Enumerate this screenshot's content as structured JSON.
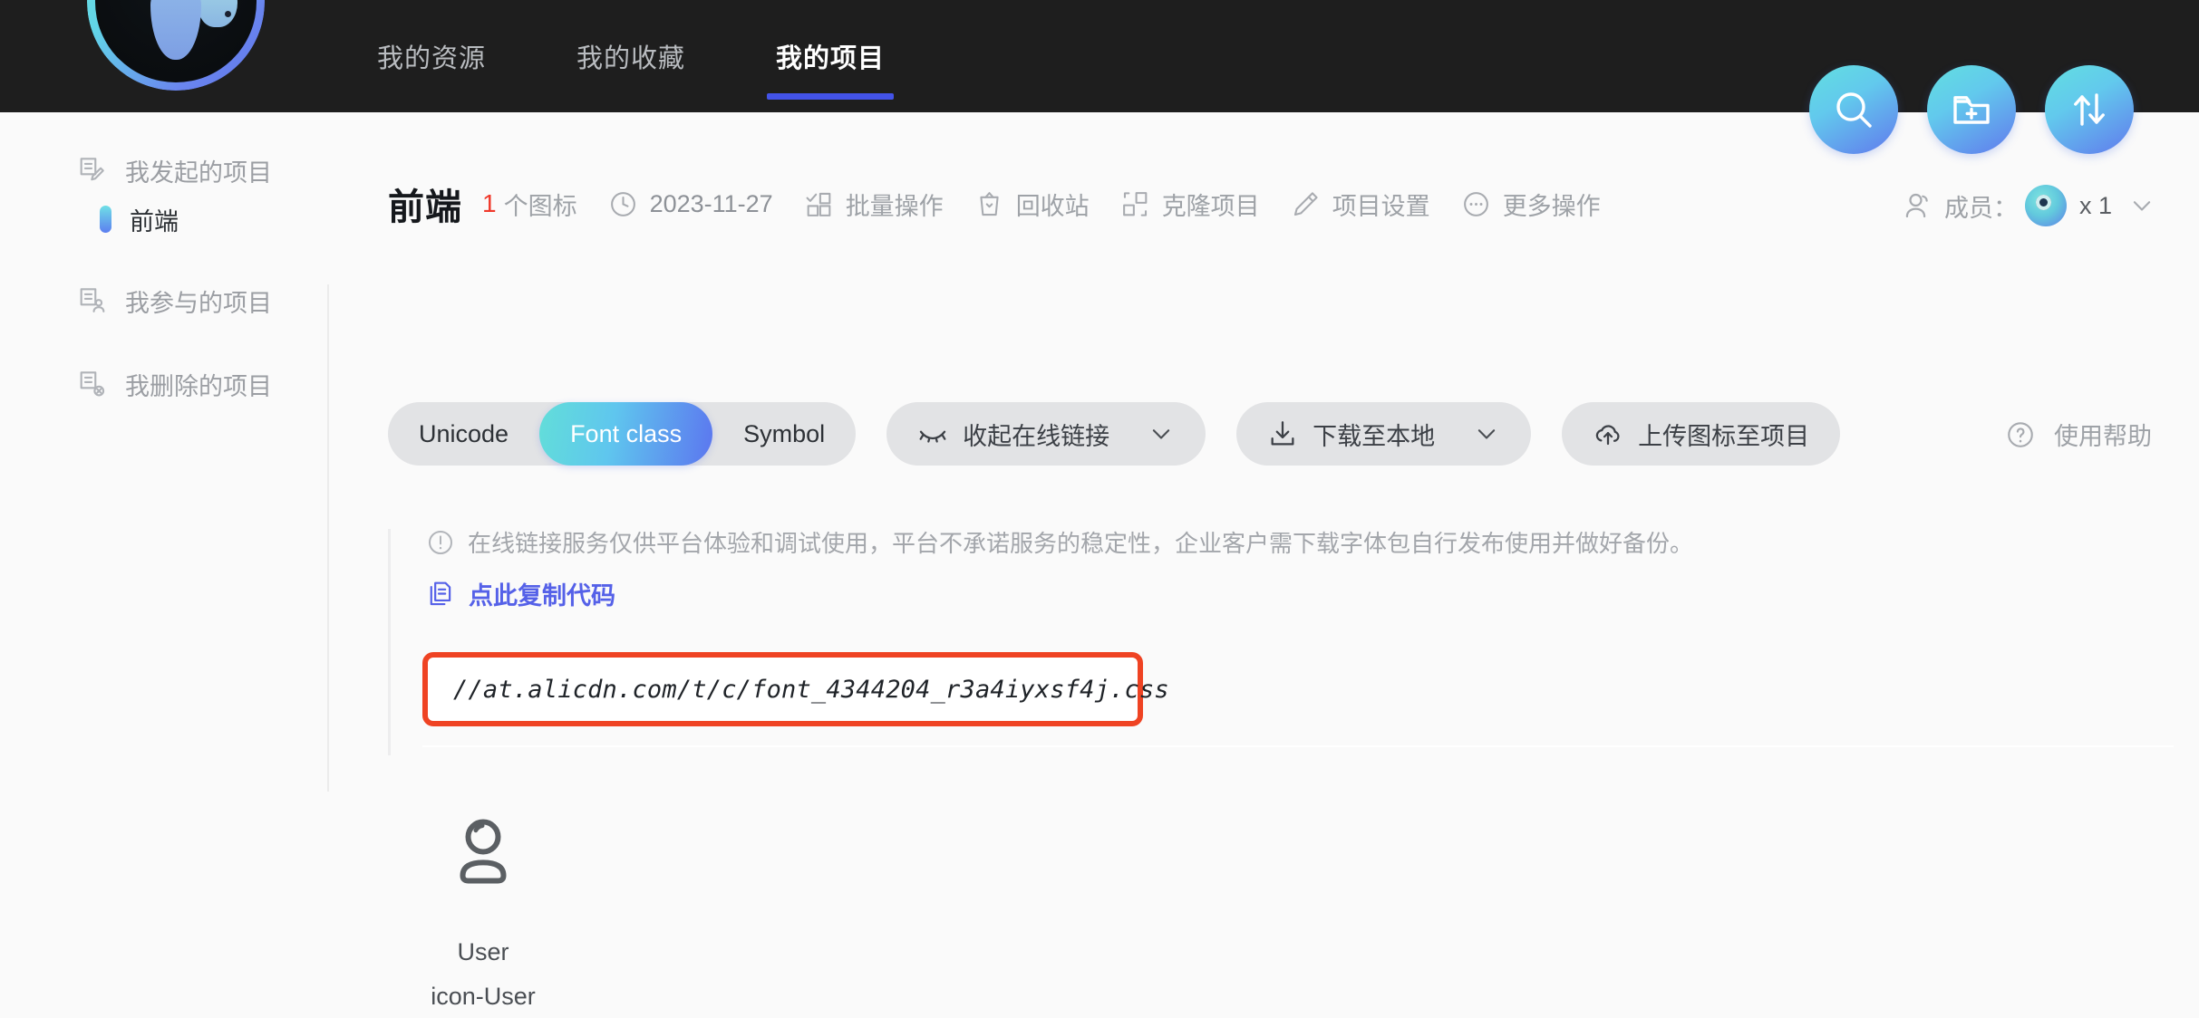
{
  "header": {
    "logo_alt": "iconfont-logo",
    "nav": [
      {
        "label": "我的资源",
        "active": false
      },
      {
        "label": "我的收藏",
        "active": false
      },
      {
        "label": "我的项目",
        "active": true
      }
    ],
    "actions": [
      {
        "name": "search-button",
        "icon": "search-icon"
      },
      {
        "name": "new-project-button",
        "icon": "folder-plus-icon"
      },
      {
        "name": "sort-button",
        "icon": "sort-arrows-icon"
      }
    ],
    "accent_underline": "#4353e8",
    "background": "#1e1e1e"
  },
  "sidebar": {
    "items": [
      {
        "label": "我发起的项目",
        "icon": "doc-edit-icon"
      },
      {
        "label": "我参与的项目",
        "icon": "doc-user-icon"
      },
      {
        "label": "我删除的项目",
        "icon": "doc-delete-icon"
      }
    ],
    "sub_items": [
      {
        "label": "前端",
        "active": true
      }
    ]
  },
  "project": {
    "title": "前端",
    "icon_count": "1",
    "icon_count_unit": "个图标",
    "date": "2023-11-27",
    "actions": [
      {
        "label": "批量操作",
        "icon": "batch-select-icon"
      },
      {
        "label": "回收站",
        "icon": "trash-icon"
      },
      {
        "label": "克隆项目",
        "icon": "clone-icon"
      },
      {
        "label": "项目设置",
        "icon": "pencil-icon"
      },
      {
        "label": "更多操作",
        "icon": "ellipsis-icon"
      }
    ],
    "members": {
      "label": "成员：",
      "count": "x 1",
      "icon": "members-icon",
      "caret": "chevron-down-icon"
    }
  },
  "toolbar": {
    "segments": [
      {
        "label": "Unicode",
        "active": false
      },
      {
        "label": "Font class",
        "active": true
      },
      {
        "label": "Symbol",
        "active": false
      }
    ],
    "buttons": [
      {
        "label": "收起在线链接",
        "icon": "eye-closed-icon",
        "caret": "chevron-down-icon"
      },
      {
        "label": "下载至本地",
        "icon": "download-icon",
        "caret": "chevron-down-icon"
      },
      {
        "label": "上传图标至项目",
        "icon": "upload-cloud-icon",
        "caret": ""
      }
    ],
    "help": {
      "label": "使用帮助",
      "icon": "question-circle-icon"
    },
    "active_gradient_from": "#62ded9",
    "active_gradient_to": "#5c76ef"
  },
  "online_link": {
    "notice": "在线链接服务仅供平台体验和调试使用，平台不承诺服务的稳定性，企业客户需下载字体包自行发布使用并做好备份。",
    "notice_icon": "exclamation-circle-icon",
    "copy_label": "点此复制代码",
    "copy_icon": "copy-icon",
    "url": "//at.alicdn.com/t/c/font_4344204_r3a4iyxsf4j.css",
    "highlight_color": "#ef4323",
    "link_color": "#5561e8"
  },
  "icons": [
    {
      "glyph": "user-icon",
      "name": "User",
      "class_name": "icon-User"
    }
  ]
}
